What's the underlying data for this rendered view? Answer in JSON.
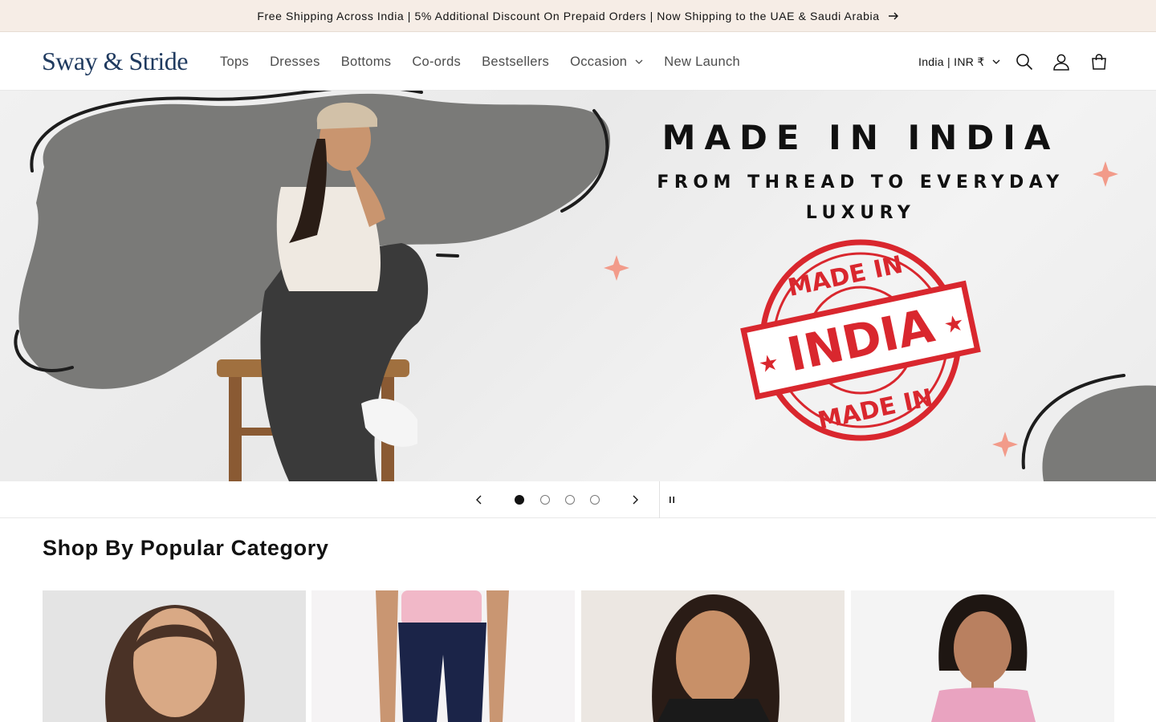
{
  "announcement": {
    "text": "Free Shipping Across India | 5% Additional Discount On Prepaid Orders | Now Shipping to the UAE & Saudi Arabia",
    "icon": "arrow-right-icon"
  },
  "header": {
    "logo_text": "Sway & Stride",
    "nav": [
      {
        "label": "Tops"
      },
      {
        "label": "Dresses"
      },
      {
        "label": "Bottoms"
      },
      {
        "label": "Co-ords"
      },
      {
        "label": "Bestsellers"
      },
      {
        "label": "Occasion",
        "has_dropdown": true
      },
      {
        "label": "New Launch"
      }
    ],
    "region_label": "India | INR ₹",
    "icons": [
      "search-icon",
      "account-icon",
      "cart-icon"
    ]
  },
  "hero": {
    "title": "MADE IN INDIA",
    "subtitle": "FROM THREAD TO EVERYDAY LUXURY",
    "stamp_text": "MADE IN INDIA",
    "stamp_color": "#d9272e"
  },
  "slider": {
    "slide_count": 4,
    "active_slide": 1,
    "prev_icon": "chevron-left-icon",
    "next_icon": "chevron-right-icon",
    "pause_icon": "pause-icon"
  },
  "category_section": {
    "title": "Shop By Popular Category"
  },
  "colors": {
    "announcement_bg": "#f6ede6",
    "logo": "#1f3a5f",
    "text": "#121212",
    "nav_text": "#4d4d4d",
    "accent_red": "#d9272e",
    "blob_gray": "#7a7a78"
  }
}
